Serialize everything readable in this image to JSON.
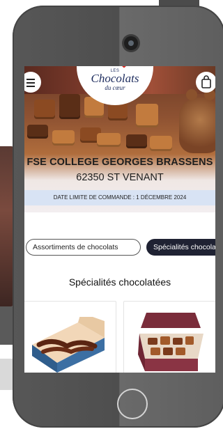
{
  "brand": {
    "logo_small": "LES",
    "logo_main": "Chocolats",
    "logo_sub": "du cœur"
  },
  "hero": {
    "school_name": "FSE COLLEGE GEORGES BRASSENS",
    "city": "62350 ST VENANT",
    "deadline": "DATE LIMITE DE COMMANDE : 1 DÉCEMBRE 2024"
  },
  "tabs": [
    {
      "label": "Assortiments de chocolats"
    },
    {
      "label": "Spécialités chocolatées"
    }
  ],
  "section": {
    "title": "Spécialités chocolatées"
  },
  "colors": {
    "accent_dark": "#1f2233",
    "brand_blue": "#1d2c5e",
    "heart_red": "#e2231a",
    "deadline_band": "#d8e3f4"
  },
  "icons": {
    "menu": "hamburger-icon",
    "cart": "shopping-bag-icon"
  }
}
